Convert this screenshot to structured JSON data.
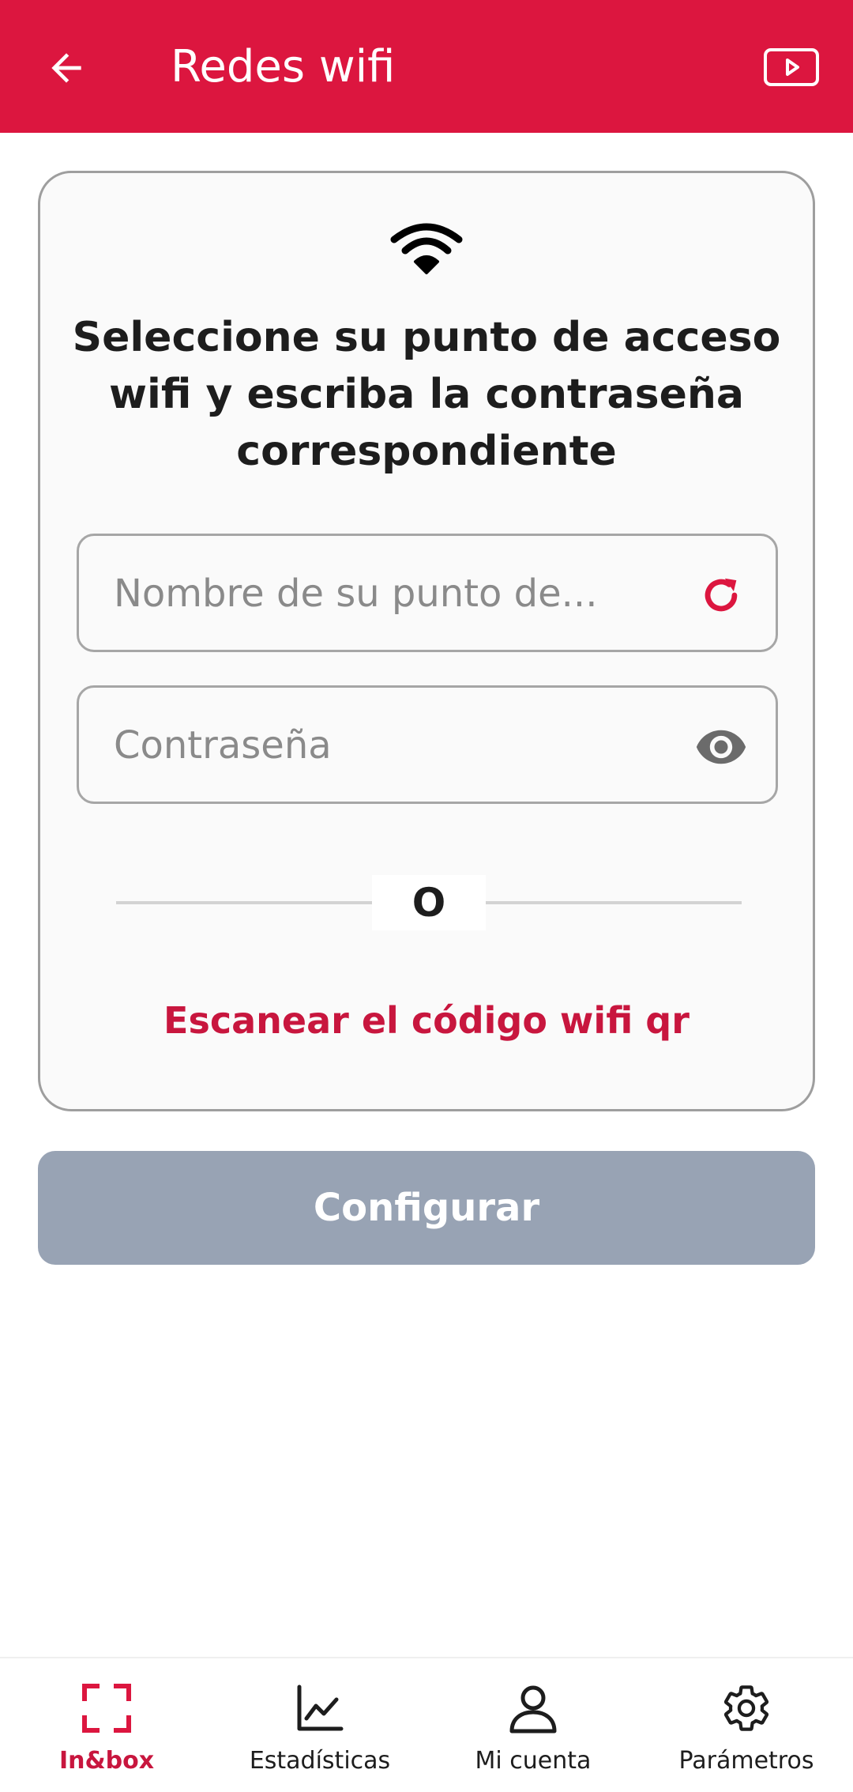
{
  "appbar": {
    "title": "Redes wifi",
    "back_icon": "arrow-left-icon",
    "video_icon": "video-play-icon"
  },
  "card": {
    "heading": "Seleccione su punto de acceso wifi y escriba la contraseña correspondiente",
    "ssid_field": {
      "placeholder": "Nombre de su punto de...",
      "value": "",
      "trailing_icon": "refresh-icon"
    },
    "password_field": {
      "placeholder": "Contraseña",
      "value": "",
      "trailing_icon": "eye-icon"
    },
    "divider_text": "O",
    "scan_link": "Escanear el código wifi qr"
  },
  "configure_button": "Configurar",
  "bottom_nav": {
    "items": [
      {
        "label": "In&box",
        "icon": "scan-frame-icon",
        "active": true
      },
      {
        "label": "Estadísticas",
        "icon": "chart-line-icon",
        "active": false
      },
      {
        "label": "Mi cuenta",
        "icon": "user-icon",
        "active": false
      },
      {
        "label": "Parámetros",
        "icon": "gear-icon",
        "active": false
      }
    ]
  },
  "colors": {
    "brand": "#dc163f",
    "accent_text": "#c8163e",
    "button_disabled": "#98a3b4",
    "card_border": "#9e9e9e"
  }
}
